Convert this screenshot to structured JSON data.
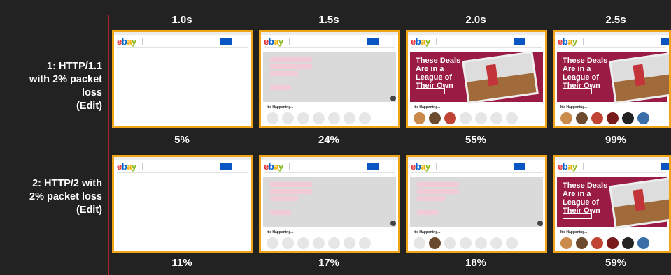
{
  "times": [
    "1.0s",
    "1.5s",
    "2.0s",
    "2.5s"
  ],
  "rows": [
    {
      "label_lines": [
        "1: HTTP/1.1",
        "with 2% packet",
        "loss",
        "(Edit)"
      ],
      "frames": [
        "blank",
        "pale",
        "hero",
        "hero-full"
      ],
      "percents": [
        "5%",
        "24%",
        "55%",
        "99%"
      ]
    },
    {
      "label_lines": [
        "2: HTTP/2 with",
        "2% packet loss",
        "(Edit)"
      ],
      "frames": [
        "blank",
        "pale",
        "pale-circles",
        "hero-full"
      ],
      "percents": [
        "11%",
        "17%",
        "18%",
        "59%"
      ]
    }
  ],
  "thumb": {
    "logo": [
      "e",
      "b",
      "a",
      "y"
    ],
    "hero_title": "These Deals Are in a League of Their Own",
    "section": "It's Happening..."
  },
  "colors": {
    "frame_border": "#f2a417",
    "background": "#222222",
    "divider": "#b0202a",
    "hero": "#9a1b44"
  }
}
